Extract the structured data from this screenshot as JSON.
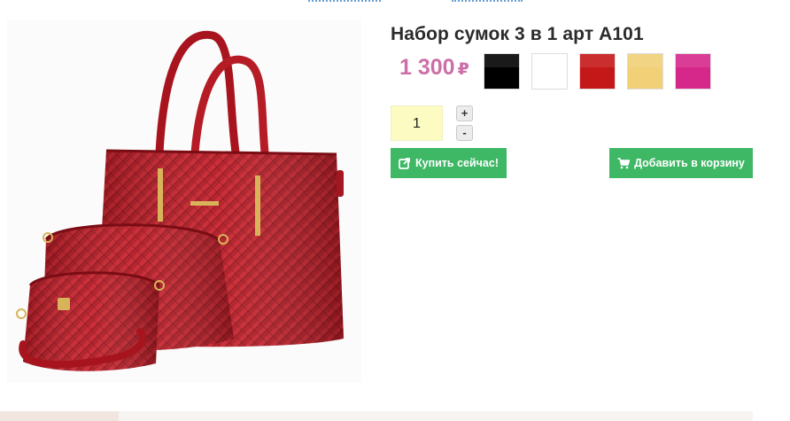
{
  "product": {
    "title": "Набор сумок 3 в 1 арт A101",
    "price": "1 300",
    "currency": "₽"
  },
  "colors": [
    {
      "name": "black",
      "hex": "#000000"
    },
    {
      "name": "white",
      "hex": "#ffffff"
    },
    {
      "name": "red",
      "hex": "#c41717"
    },
    {
      "name": "beige",
      "hex": "#f1d078"
    },
    {
      "name": "pink",
      "hex": "#d6278b"
    }
  ],
  "quantity": {
    "value": "1",
    "plus_label": "+",
    "minus_label": "-"
  },
  "actions": {
    "buy_now_label": "Купить сейчас!",
    "add_to_cart_label": "Добавить в корзину",
    "buy_icon": "external-link-icon",
    "cart_icon": "cart-icon",
    "button_color": "#3fb866"
  },
  "theme": {
    "price_color": "#cc6fa8",
    "qty_bg": "#fbfbc2"
  }
}
